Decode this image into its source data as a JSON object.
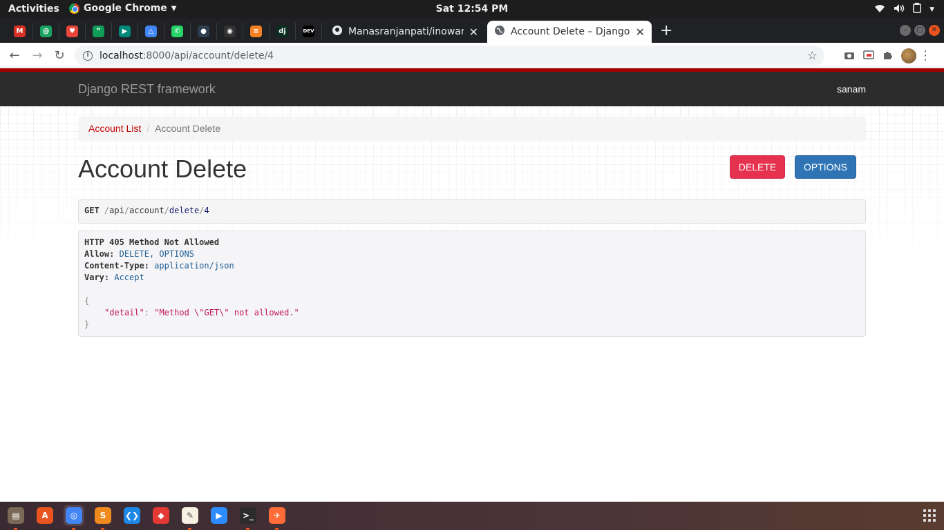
{
  "system_bar": {
    "activities": "Activities",
    "app_name": "Google Chrome",
    "clock": "Sat 12:54 PM"
  },
  "browser": {
    "pinned_tabs": [
      {
        "icon": "gmail-icon",
        "color": "#d93025",
        "glyph": "M"
      },
      {
        "icon": "at-sign-icon",
        "color": "#1aa260",
        "glyph": "@"
      },
      {
        "icon": "heart-app-icon",
        "color": "#e8453c",
        "glyph": "♥"
      },
      {
        "icon": "hangouts-icon",
        "color": "#0f9d58",
        "glyph": "❞"
      },
      {
        "icon": "meet-icon",
        "color": "#00897b",
        "glyph": "▶"
      },
      {
        "icon": "drive-icon",
        "color": "#4285f4",
        "glyph": "△"
      },
      {
        "icon": "whatsapp-icon",
        "color": "#25d366",
        "glyph": "✆"
      },
      {
        "icon": "circle-app-icon",
        "color": "#2c3e50",
        "glyph": "●"
      },
      {
        "icon": "github-icon",
        "color": "#333333",
        "glyph": "◉"
      },
      {
        "icon": "stackoverflow-icon",
        "color": "#f48024",
        "glyph": "≡"
      },
      {
        "icon": "django-icon",
        "color": "#092e20",
        "glyph": "dj"
      },
      {
        "icon": "dev-icon",
        "color": "#000000",
        "glyph": "DEV"
      }
    ],
    "tabs": [
      {
        "title": "Manasranjanpati/inoware",
        "active": false
      },
      {
        "title": "Account Delete – Django R",
        "active": true
      }
    ],
    "url_host": "localhost",
    "url_path": ":8000/api/account/delete/4"
  },
  "navbar": {
    "brand": "Django REST framework",
    "user": "sanam"
  },
  "breadcrumb": {
    "parent": "Account List",
    "current": "Account Delete"
  },
  "page": {
    "title": "Account Delete",
    "delete_label": "DELETE",
    "options_label": "OPTIONS"
  },
  "request": {
    "method": "GET",
    "path_segments": [
      "api",
      "account",
      "delete",
      "4"
    ]
  },
  "response": {
    "status": "HTTP 405 Method Not Allowed",
    "headers": [
      {
        "name": "Allow:",
        "value": "DELETE, OPTIONS"
      },
      {
        "name": "Content-Type:",
        "value": "application/json"
      },
      {
        "name": "Vary:",
        "value": "Accept"
      }
    ],
    "body_open": "{",
    "body_key": "\"detail\"",
    "body_colon": ": ",
    "body_value": "\"Method \\\"GET\\\" not allowed.\"",
    "body_close": "}"
  },
  "dock": {
    "apps": [
      {
        "name": "files",
        "color": "#7a6a55",
        "glyph": "▤",
        "running": true
      },
      {
        "name": "software",
        "color": "#e95420",
        "glyph": "A",
        "running": false
      },
      {
        "name": "chrome",
        "color": "#4285f4",
        "glyph": "◎",
        "running": true
      },
      {
        "name": "sublime",
        "color": "#f08a1e",
        "glyph": "S",
        "running": true
      },
      {
        "name": "vscode",
        "color": "#1e88e5",
        "glyph": "❮❯",
        "running": false
      },
      {
        "name": "git-tool",
        "color": "#e53935",
        "glyph": "◆",
        "running": false
      },
      {
        "name": "text-editor",
        "color": "#f5f0e1",
        "glyph": "✎",
        "running": true
      },
      {
        "name": "zoom",
        "color": "#2d8cff",
        "glyph": "▶",
        "running": false
      },
      {
        "name": "terminal",
        "color": "#2b2b2b",
        "glyph": ">_",
        "running": true
      },
      {
        "name": "postman",
        "color": "#ff6c37",
        "glyph": "✈",
        "running": true
      }
    ]
  }
}
